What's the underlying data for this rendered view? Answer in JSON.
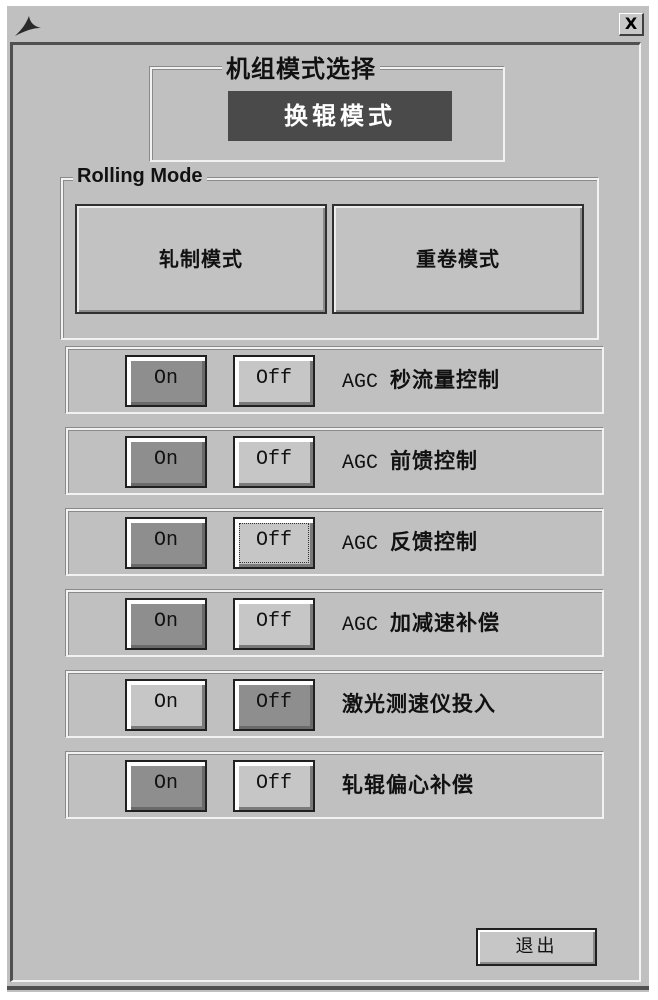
{
  "window": {
    "icon": "app-logo-icon",
    "close_label": "X"
  },
  "unit_mode": {
    "title": "机组模式选择",
    "current_mode": "换辊模式",
    "indicator_color": "#4a4a4a"
  },
  "rolling_mode": {
    "title": "Rolling Mode",
    "buttons": [
      {
        "label": "轧制模式"
      },
      {
        "label": "重卷模式"
      }
    ]
  },
  "controls": [
    {
      "prefix": "AGC",
      "label": "秒流量控制",
      "on_label": "On",
      "off_label": "Off",
      "state": "on"
    },
    {
      "prefix": "AGC",
      "label": "前馈控制",
      "on_label": "On",
      "off_label": "Off",
      "state": "on"
    },
    {
      "prefix": "AGC",
      "label": "反馈控制",
      "on_label": "On",
      "off_label": "Off",
      "state": "on"
    },
    {
      "prefix": "AGC",
      "label": "加减速补偿",
      "on_label": "On",
      "off_label": "Off",
      "state": "on"
    },
    {
      "prefix": "",
      "label": "激光测速仪投入",
      "on_label": "On",
      "off_label": "Off",
      "state": "off"
    },
    {
      "prefix": "",
      "label": "轧辊偏心补偿",
      "on_label": "On",
      "off_label": "Off",
      "state": "on"
    }
  ],
  "footer": {
    "exit_label": "退出"
  },
  "colors": {
    "background": "#c0c0c0",
    "active_button": "#8e8e8e",
    "inactive_button": "#c6c6c6"
  }
}
